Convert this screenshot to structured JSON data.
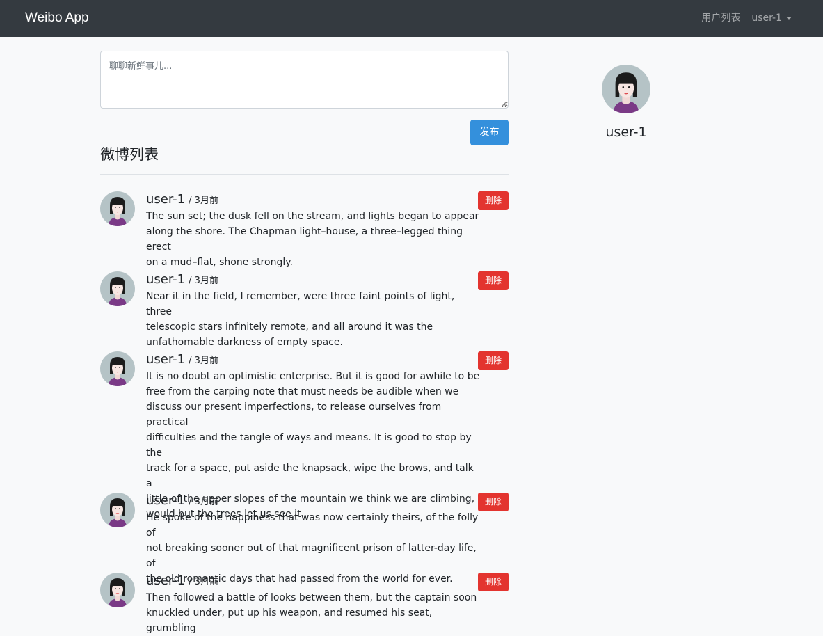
{
  "navbar": {
    "brand": "Weibo App",
    "users_link": "用户列表",
    "current_user": "user-1"
  },
  "composer": {
    "placeholder": "聊聊新鲜事儿...",
    "value": "",
    "submit_label": "发布"
  },
  "feed": {
    "title": "微博列表",
    "delete_label": "删除",
    "posts": [
      {
        "user": "user-1",
        "time": "3月前",
        "lines": [
          "The sun set; the dusk fell on the stream, and lights began to appear",
          "along the shore. The Chapman light–house, a three–legged thing erect",
          "on a mud–flat, shone strongly."
        ]
      },
      {
        "user": "user-1",
        "time": "3月前",
        "lines": [
          "Near it in the field, I remember, were three faint points of light, three",
          "telescopic stars infinitely remote, and all around it was the",
          "unfathomable darkness of empty space."
        ]
      },
      {
        "user": "user-1",
        "time": "3月前",
        "lines": [
          "It is no doubt an optimistic enterprise. But it is good for awhile to be",
          "free from the carping note that must needs be audible when we",
          "discuss our present imperfections, to release ourselves from practical",
          "difficulties and the tangle of ways and means. It is good to stop by the",
          "track for a space, put aside the knapsack, wipe the brows, and talk a",
          "little of the upper slopes of the mountain we think we are climbing,",
          "would but the trees let us see it"
        ]
      },
      {
        "user": "user-1",
        "time": "3月前",
        "lines": [
          "He spoke of the happiness that was now certainly theirs, of the folly of",
          "not breaking sooner out of that magnificent prison of latter-day life, of",
          "the old romantic days that had passed from the world for ever."
        ]
      },
      {
        "user": "user-1",
        "time": "3月前",
        "lines": [
          "Then followed a battle of looks between them, but the captain soon",
          "knuckled under, put up his weapon, and resumed his seat, grumbling"
        ]
      }
    ]
  },
  "profile": {
    "name": "user-1"
  },
  "colors": {
    "navbar_bg": "#343a40",
    "primary": "#3490dc",
    "danger": "#e3342f",
    "page_bg": "#f8f9fa"
  }
}
